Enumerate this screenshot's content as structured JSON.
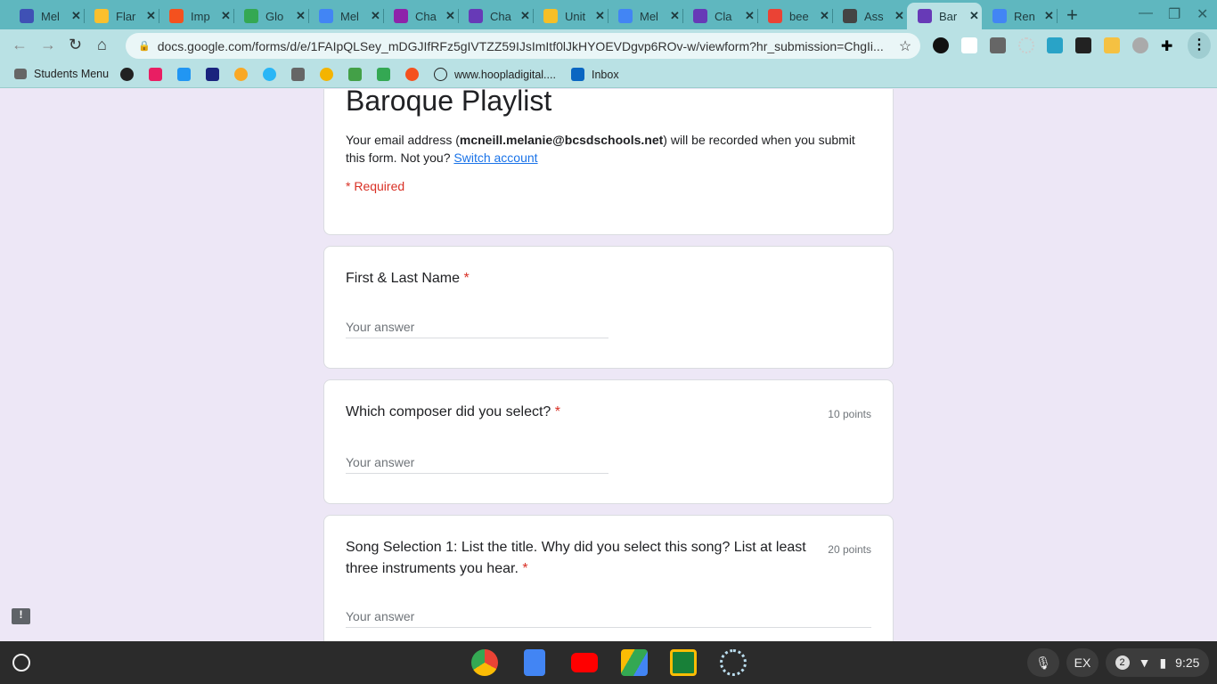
{
  "tabs": [
    {
      "label": "Mel",
      "color": "#3f51b5"
    },
    {
      "label": "Flar",
      "color": "#fbc02d"
    },
    {
      "label": "Imp",
      "color": "#f4511e"
    },
    {
      "label": "Glo",
      "color": "#34a853"
    },
    {
      "label": "Mel",
      "color": "#4285f4"
    },
    {
      "label": "Cha",
      "color": "#8e24aa"
    },
    {
      "label": "Cha",
      "color": "#673ab7"
    },
    {
      "label": "Unit",
      "color": "#f6bf26"
    },
    {
      "label": "Mel",
      "color": "#4285f4"
    },
    {
      "label": "Cla",
      "color": "#673ab7"
    },
    {
      "label": "bee",
      "color": "#ea4335"
    },
    {
      "label": "Ass",
      "color": "#444444"
    },
    {
      "label": "Bar",
      "color": "#673ab7",
      "active": true
    },
    {
      "label": "Ren",
      "color": "#4285f4"
    }
  ],
  "address": {
    "url": "docs.google.com/forms/d/e/1FAIpQLSey_mDGJIfRFz5gIVTZZ59IJsImItf0lJkHYOEVDgvp6ROv-w/viewform?hr_submission=ChgIi..."
  },
  "bookmarks": {
    "students_menu": "Students Menu",
    "hoopla": "www.hoopladigital....",
    "inbox": "Inbox"
  },
  "form": {
    "title": "Baroque Playlist",
    "email_prefix": "Your email address (",
    "email": "mcneill.melanie@bcsdschools.net",
    "email_suffix": ") will be recorded when you submit this form. Not you? ",
    "switch_account": "Switch account",
    "required_note": "* Required",
    "questions": [
      {
        "label": "First & Last Name",
        "required": "*",
        "placeholder": "Your answer"
      },
      {
        "label": "Which composer did you select?",
        "required": "*",
        "points": "10 points",
        "placeholder": "Your answer"
      },
      {
        "label": "Song Selection 1: List the title. Why did you select this song? List at least three instruments you hear.",
        "required": "*",
        "points": "20 points",
        "placeholder": "Your answer"
      }
    ]
  },
  "tray": {
    "ime": "EX",
    "notifications": "2",
    "time": "9:25"
  }
}
